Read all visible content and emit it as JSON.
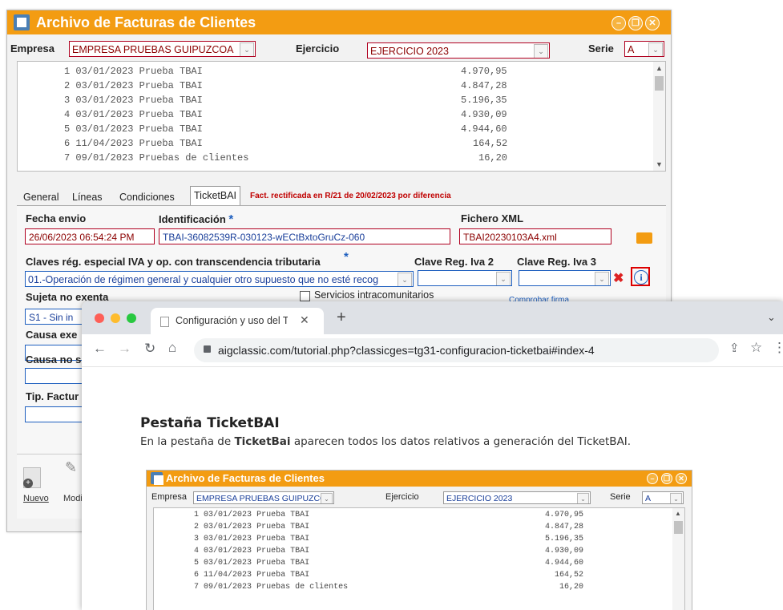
{
  "app": {
    "title": "Archivo de Facturas de Clientes",
    "empresa_label": "Empresa",
    "empresa_value": "EMPRESA PRUEBAS GUIPUZCOA",
    "ejercicio_label": "Ejercicio",
    "ejercicio_value": "EJERCICIO 2023",
    "serie_label": "Serie",
    "serie_value": "A",
    "invoices": [
      {
        "num": "1",
        "date": "03/01/2023",
        "desc": "Prueba TBAI",
        "amount": "4.970,95"
      },
      {
        "num": "2",
        "date": "03/01/2023",
        "desc": "Prueba TBAI",
        "amount": "4.847,28"
      },
      {
        "num": "3",
        "date": "03/01/2023",
        "desc": "Prueba TBAI",
        "amount": "5.196,35"
      },
      {
        "num": "4",
        "date": "03/01/2023",
        "desc": "Prueba TBAI",
        "amount": "4.930,09"
      },
      {
        "num": "5",
        "date": "03/01/2023",
        "desc": "Prueba TBAI",
        "amount": "4.944,60"
      },
      {
        "num": "6",
        "date": "11/04/2023",
        "desc": "Prueba TBAI",
        "amount": "164,52"
      },
      {
        "num": "7",
        "date": "09/01/2023",
        "desc": "Pruebas de clientes",
        "amount": "16,20"
      }
    ],
    "tabs": [
      "General",
      "Líneas",
      "Condiciones",
      "TicketBAI"
    ],
    "rect_notice": "Fact. rectificada en R/21 de 20/02/2023 por diferencia",
    "fecha_envio_label": "Fecha envio",
    "fecha_envio_value": "26/06/2023 06:54:24 PM",
    "identificacion_label": "Identificación",
    "identificacion_value": "TBAI-36082539R-030123-wECtBxtoGruCz-060",
    "fichero_label": "Fichero XML",
    "fichero_value": "TBAI20230103A4.xml",
    "claves_label": "Claves rég. especial IVA y op. con transcendencia tributaria",
    "claves_value": "01.-Operación de régimen general y cualquier otro supuesto que no esté recog",
    "clave2_label": "Clave Reg. Iva 2",
    "clave3_label": "Clave Reg. Iva 3",
    "sujeta_label": "Sujeta no exenta",
    "sujeta_value": "S1 - Sin in",
    "servicios_label": "Servicios intracomunitarios",
    "comprobar_label": "Comprobar firma",
    "causa_exe_label": "Causa exe",
    "causa_no_label": "Causa no s",
    "tip_factura_label": "Tip. Factur",
    "nuevo_label": "Nuevo",
    "modif_label": "Modi",
    "asterisk": "*",
    "close_glyph": "✖",
    "info_glyph": "i"
  },
  "browser": {
    "tab_title": "Configuración y uso del Ticket",
    "url": "aigclassic.com/tutorial.php?classicges=tg31-configuracion-ticketbai#index-4",
    "page_heading": "Pestaña TicketBAI",
    "page_text_before": "En la pestaña de ",
    "page_text_bold": "TicketBai",
    "page_text_after": " aparecen todos los datos relativos a generación del TicketBAI."
  },
  "colors": {
    "title_orange": "#f39c12",
    "dark_red_text": "#8b0000",
    "blue_text": "#1a3f9a",
    "info_highlight": "#dd0000"
  }
}
